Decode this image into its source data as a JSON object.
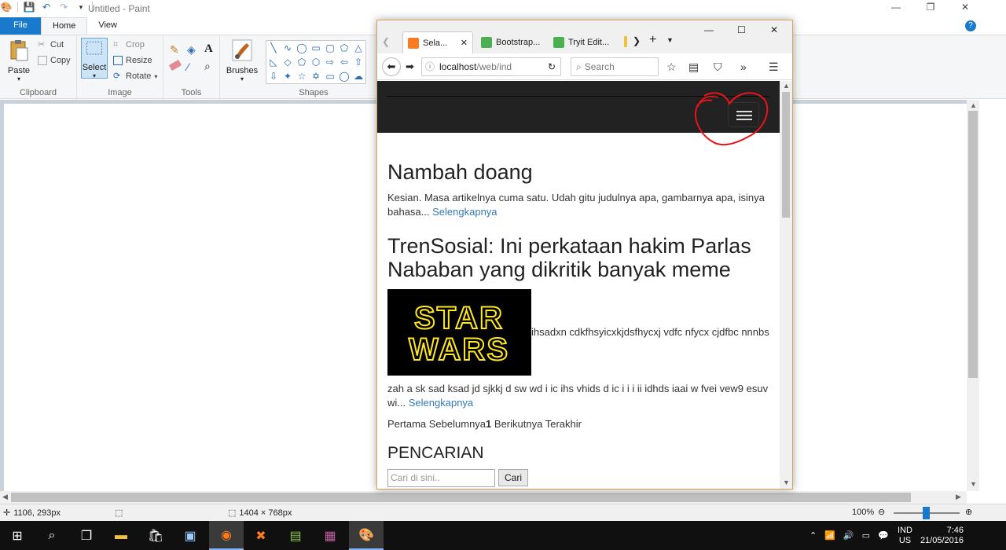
{
  "paint": {
    "title": "Untitled - Paint",
    "tabs": [
      "File",
      "Home",
      "View"
    ],
    "clipboard": {
      "label": "Clipboard",
      "paste": "Paste",
      "cut": "Cut",
      "copy": "Copy"
    },
    "image": {
      "label": "Image",
      "select": "Select",
      "crop": "Crop",
      "resize": "Resize",
      "rotate": "Rotate"
    },
    "tools": {
      "label": "Tools"
    },
    "brushes": {
      "label": "Brushes"
    },
    "shapes": {
      "label": "Shapes"
    },
    "status": {
      "cursor": "1106, 293px",
      "size": "1404 × 768px",
      "zoom": "100%"
    }
  },
  "browser": {
    "tabs": [
      {
        "label": "Sela...",
        "active": true
      },
      {
        "label": "Bootstrap..."
      },
      {
        "label": "Tryit Edit..."
      }
    ],
    "url_host": "localhost",
    "url_path": "/web/ind",
    "search_placeholder": "Search"
  },
  "site": {
    "posts": [
      {
        "title": "Nambah doang",
        "excerpt": "Kesian. Masa artikelnya cuma satu. Udah gitu judulnya apa, gambarnya apa, isinya bahasa...",
        "more": "Selengkapnya"
      },
      {
        "title": "TrenSosial: Ini perkataan hakim Parlas Nababan yang dikritik banyak meme",
        "image_text_1": "STAR",
        "image_text_2": "WARS",
        "inline_text": "ihsadxn cdkfhsyicxkjdsfhycxj vdfc nfycx cjdfbc nnnbs",
        "excerpt": "zah a sk sad ksad jd sjkkj d sw wd i ic ihs vhids d ic i i i ii idhds iaai w fvei vew9 esuv wi...",
        "more": "Selengkapnya"
      }
    ],
    "pagination": {
      "first": "Pertama",
      "prev": "Sebelumnya",
      "current": "1",
      "next": "Berikutnya",
      "last": "Terakhir"
    },
    "search": {
      "heading": "PENCARIAN",
      "placeholder": "Cari di sini..",
      "button": "Cari"
    }
  },
  "taskbar": {
    "lang_1": "IND",
    "lang_2": "US",
    "time": "7:46",
    "date": "21/05/2016"
  },
  "colors": {
    "accent": "#1979ca",
    "link": "#337ab7",
    "navbar": "#222222",
    "annotation": "#e8141c"
  }
}
